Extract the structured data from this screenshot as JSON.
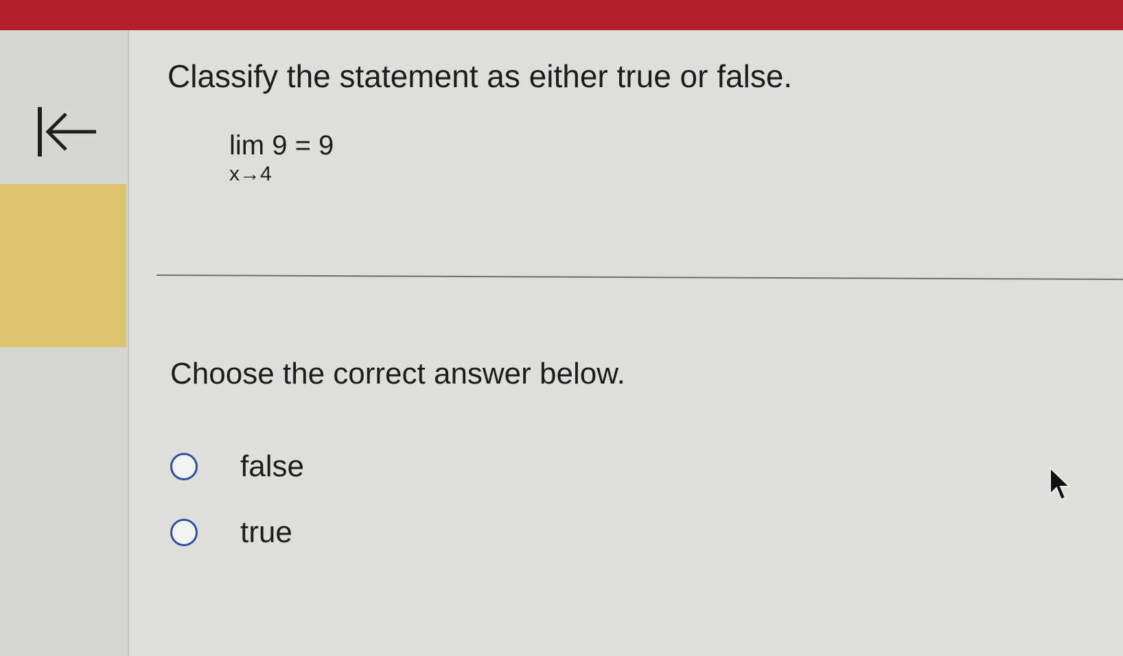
{
  "question": {
    "title": "Classify the statement as either true or false.",
    "statement_line1": "lim 9 = 9",
    "statement_line2": "x→4"
  },
  "answer": {
    "prompt": "Choose the correct answer below.",
    "options": [
      {
        "label": "false"
      },
      {
        "label": "true"
      }
    ]
  },
  "icons": {
    "collapse": "collapse-left-arrow-icon",
    "cursor": "mouse-pointer-icon"
  },
  "colors": {
    "top_bar": "#b3202a",
    "highlight": "#dfc46e",
    "radio_border": "#2c4f9e"
  }
}
